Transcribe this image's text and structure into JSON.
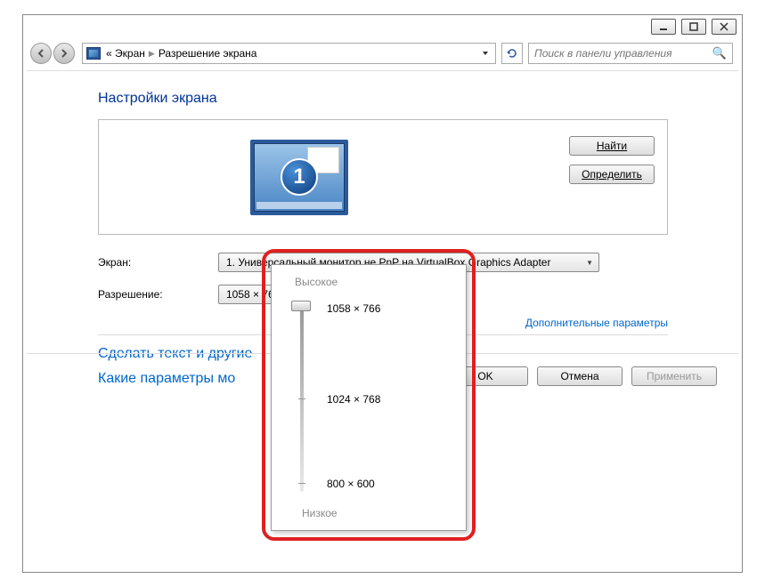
{
  "breadcrumb": {
    "root": "Экран",
    "page": "Разрешение экрана"
  },
  "search": {
    "placeholder": "Поиск в панели управления"
  },
  "heading": "Настройки экрана",
  "monitor_number": "1",
  "buttons": {
    "find": "Найти",
    "detect": "Определить",
    "ok": "OK",
    "cancel": "Отмена",
    "apply": "Применить"
  },
  "fields": {
    "screen_label": "Экран:",
    "screen_value": "1. Универсальный монитор не PnP на VirtualBox Graphics Adapter",
    "resolution_label": "Разрешение:",
    "resolution_value": "1058 × 766"
  },
  "links": {
    "advanced": "Дополнительные параметры",
    "text_size": "Сделать текст и другие",
    "which_params": "Какие параметры мо"
  },
  "slider": {
    "high": "Высокое",
    "low": "Низкое",
    "options": [
      "1058 × 766",
      "1024 × 768",
      "800 × 600"
    ]
  },
  "chevrons": "«"
}
